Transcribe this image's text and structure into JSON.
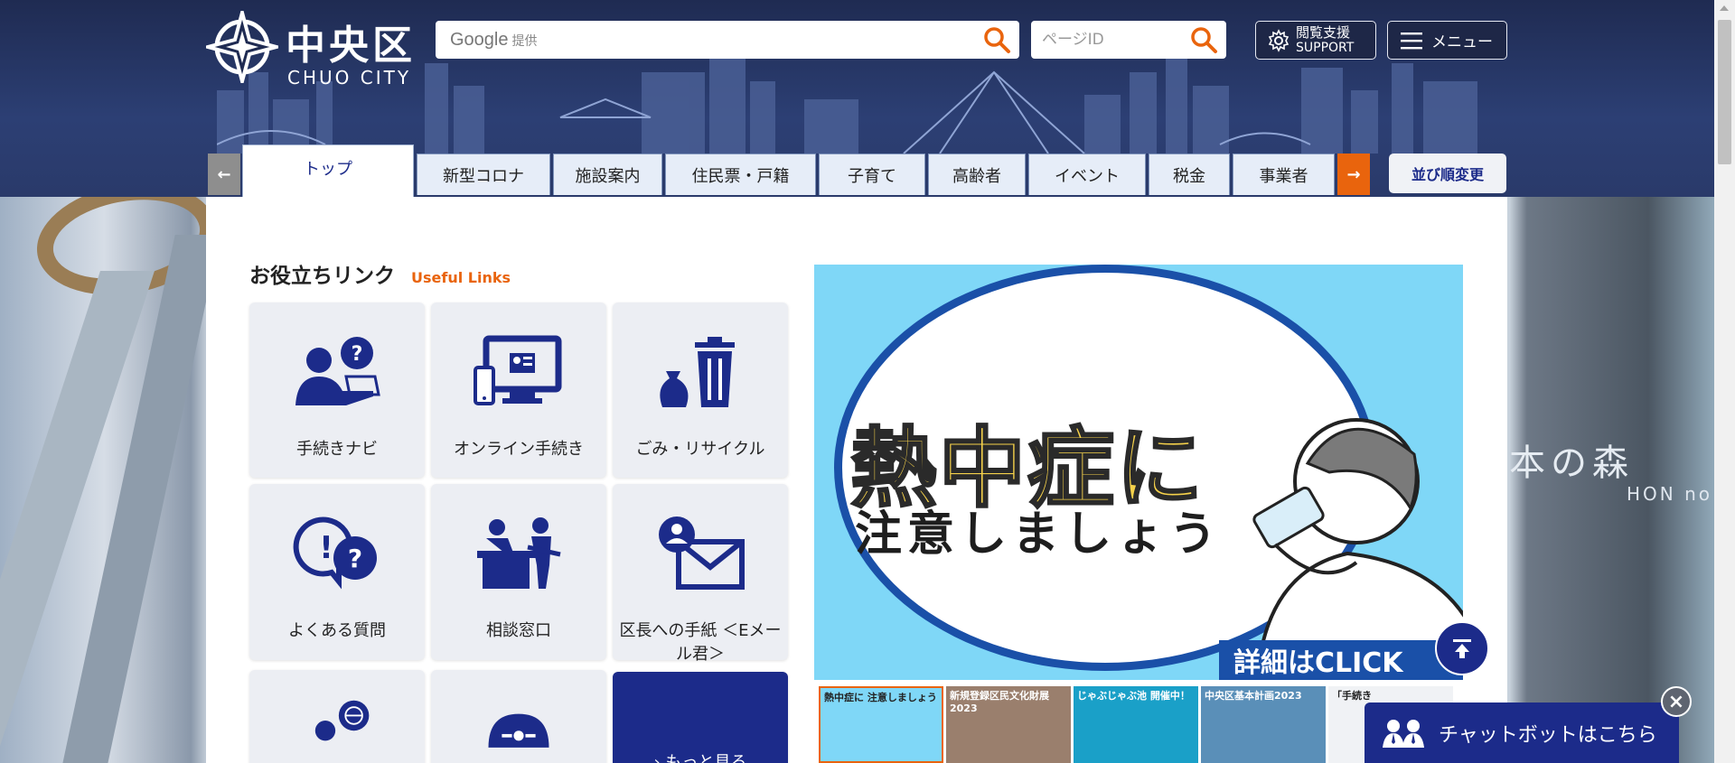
{
  "header": {
    "logo_jp": "中央区",
    "logo_en": "CHUO CITY",
    "search_brand": "Google",
    "search_brand_sub": "提供",
    "pageid_placeholder": "ページID",
    "support_line1": "閲覧支援",
    "support_line2": "SUPPORT",
    "menu_label": "メニュー"
  },
  "tabs": [
    {
      "label": "トップ"
    },
    {
      "label": "新型コロナ"
    },
    {
      "label": "施設案内"
    },
    {
      "label": "住民票・戸籍"
    },
    {
      "label": "子育て"
    },
    {
      "label": "高齢者"
    },
    {
      "label": "イベント"
    },
    {
      "label": "税金"
    },
    {
      "label": "事業者"
    }
  ],
  "tabs_active_index": 0,
  "reorder_label": "並び順変更",
  "useful_links": {
    "title_jp": "お役立ちリンク",
    "title_en": "Useful Links",
    "items": [
      {
        "label": "手続きナビ",
        "icon": "procedure-navi-icon"
      },
      {
        "label": "オンライン手続き",
        "icon": "online-procedure-icon"
      },
      {
        "label": "ごみ・リサイクル",
        "icon": "trash-recycle-icon"
      },
      {
        "label": "よくある質問",
        "icon": "faq-icon"
      },
      {
        "label": "相談窓口",
        "icon": "consultation-icon"
      },
      {
        "label": "区長への手紙 ＜Eメール君＞",
        "icon": "letter-mail-icon"
      }
    ],
    "more_label": "もっと見る"
  },
  "banner": {
    "line1": "熱中症に",
    "line2": "注意しましょう",
    "click": "詳細はCLICK"
  },
  "thumbnails": [
    {
      "caption": "熱中症に 注意しましょう"
    },
    {
      "caption": "新規登録区民文化財展2023"
    },
    {
      "caption": "じゃぶじゃぶ池 開催中！"
    },
    {
      "caption": "中央区基本計画2023"
    },
    {
      "caption": "「手続き"
    }
  ],
  "chatbot_label": "チャットボットはこちら",
  "colors": {
    "navy": "#1c2b8a",
    "accent_orange": "#e9640d",
    "header_bg": "#2c3f74"
  }
}
